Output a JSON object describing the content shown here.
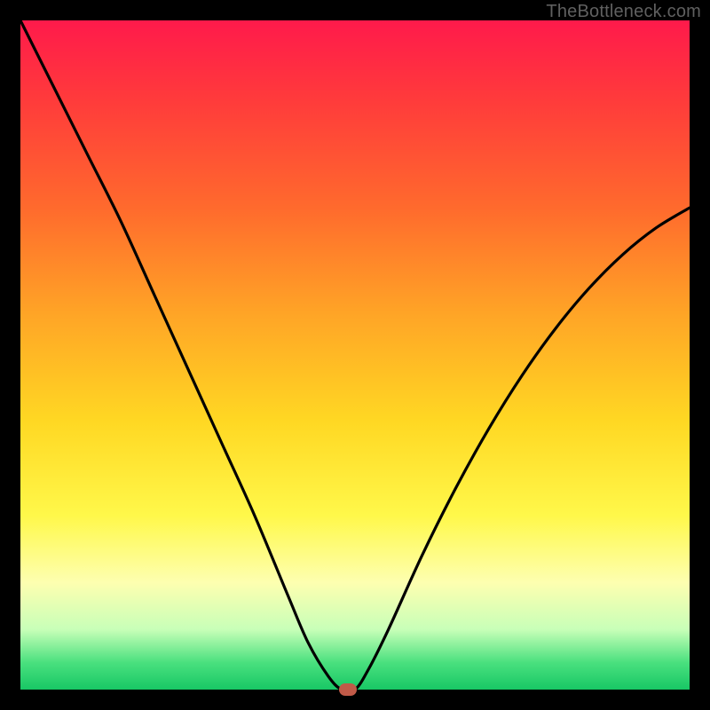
{
  "watermark": "TheBottleneck.com",
  "colors": {
    "frame": "#000000",
    "curve": "#000000",
    "marker": "#c15a48"
  },
  "chart_data": {
    "type": "line",
    "title": "",
    "xlabel": "",
    "ylabel": "",
    "xlim": [
      0,
      100
    ],
    "ylim": [
      0,
      100
    ],
    "grid": false,
    "legend": false,
    "x": [
      0,
      5,
      10,
      15,
      20,
      25,
      30,
      35,
      40,
      43,
      46,
      48,
      50,
      52,
      55,
      60,
      65,
      70,
      75,
      80,
      85,
      90,
      95,
      100
    ],
    "y": [
      100,
      90,
      80,
      70,
      59,
      48,
      37,
      26,
      14,
      7,
      2,
      0,
      0,
      3,
      9,
      20,
      30,
      39,
      47,
      54,
      60,
      65,
      69,
      72
    ],
    "marker": {
      "x": 49,
      "y": 0
    },
    "notes": "Single V-shaped curve on a vertical rainbow gradient (red top → green bottom). No axis ticks or labels rendered. Values are estimated as percentages of the plot area."
  }
}
